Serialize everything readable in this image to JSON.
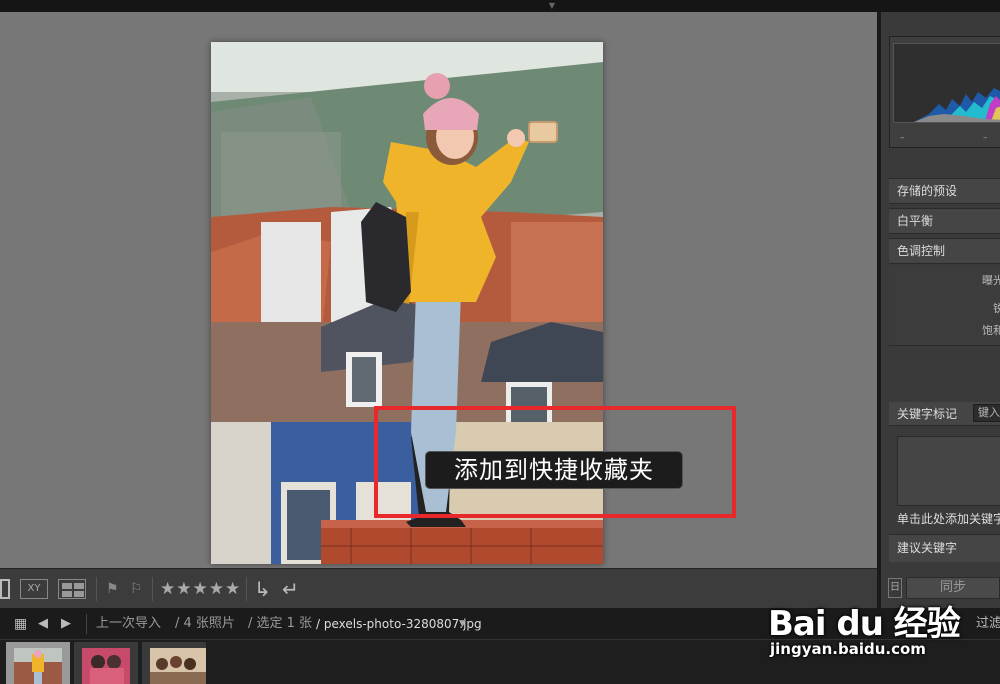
{
  "tooltip": {
    "text": "添加到快捷收藏夹"
  },
  "right_panel": {
    "histogram_dash_left": "–",
    "histogram_dash_right": "–",
    "saved_preset_label": "存储的预设",
    "white_balance_label": "白平衡",
    "tone_control_label": "色调控制",
    "exposure_label": "曝光",
    "contrast_label": "锐",
    "saturation_label": "饱和",
    "keywording_label": "关键字标记",
    "enter_keyword_label": "键入关",
    "click_add_keyword": "单击此处添加关键字",
    "suggested_keywords_label": "建议关键字",
    "sync_button": "同步",
    "sync_toggle": "日"
  },
  "toolbar": {
    "compare_label": "XY",
    "stars": "★★★★★"
  },
  "path_bar": {
    "source": "上一次导入",
    "count": "/ 4 张照片",
    "selected": "/ 选定 1 张",
    "filename": "/ pexels-photo-3280807.jpg",
    "filter_label": "过滤"
  },
  "watermark": {
    "logo": "Bai du 经验",
    "url": "jingyan.baidu.com"
  },
  "colors": {
    "highlight_box": "#e8282b",
    "loupe_background": "#777777",
    "jacket_yellow": "#f0b42a"
  },
  "icons": {
    "grid": "grid-view-icon",
    "back": "arrow-left-icon",
    "forward": "arrow-right-icon",
    "flag": "flag-icon",
    "reject": "reject-flag-icon",
    "rotate_left": "rotate-left-icon",
    "rotate_right": "rotate-right-icon"
  }
}
